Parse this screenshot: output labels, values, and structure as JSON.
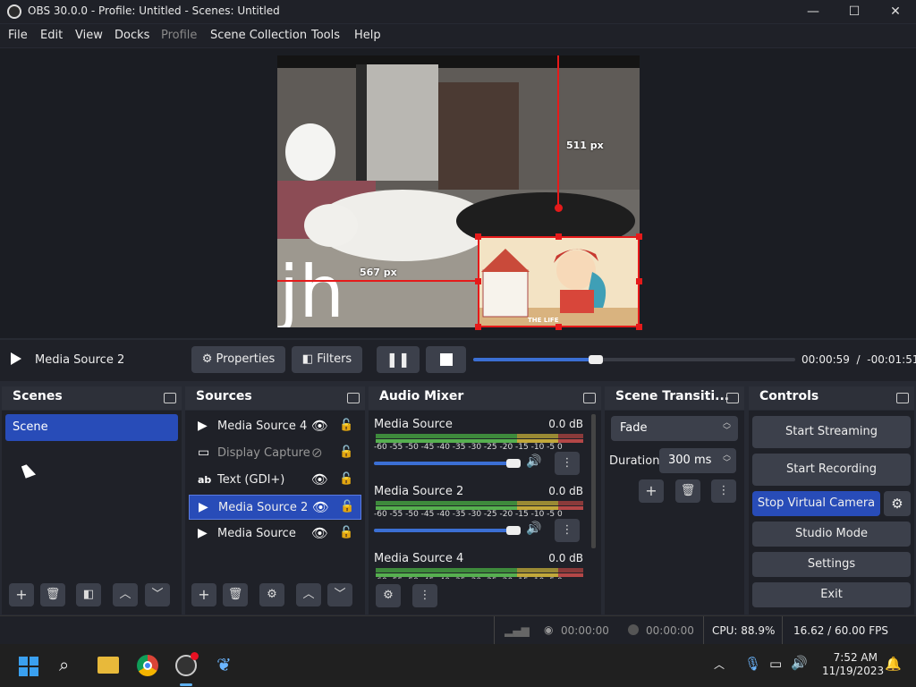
{
  "window": {
    "title": "OBS 30.0.0 - Profile: Untitled - Scenes: Untitled"
  },
  "menu": [
    "File",
    "Edit",
    "View",
    "Docks",
    "Profile",
    "Scene Collection",
    "Tools",
    "Help"
  ],
  "preview": {
    "dim_vertical": "511 px",
    "dim_horizontal": "567 px",
    "overlay_text": "jh",
    "cartoon_caption": "THE LIFE"
  },
  "transport": {
    "source_name": "Media Source 2",
    "properties": "Properties",
    "filters": "Filters",
    "time_current": "00:00:59",
    "time_sep": "/",
    "time_remaining": "-00:01:51",
    "progress": 0.38
  },
  "scenes": {
    "title": "Scenes",
    "items": [
      "Scene"
    ]
  },
  "sources": {
    "title": "Sources",
    "items": [
      {
        "icon": "▶",
        "label": "Media Source 4",
        "visible": true
      },
      {
        "icon": "▭",
        "label": "Display Capture",
        "visible": false
      },
      {
        "icon": "ab",
        "label": "Text (GDI+)",
        "visible": true
      },
      {
        "icon": "▶",
        "label": "Media Source 2",
        "visible": true
      },
      {
        "icon": "▶",
        "label": "Media Source",
        "visible": true
      }
    ]
  },
  "mixer": {
    "title": "Audio Mixer",
    "scale": "-60 -55 -50 -45 -40 -35 -30 -25 -20 -15 -10 -5 0",
    "channels": [
      {
        "name": "Media Source",
        "db": "0.0 dB"
      },
      {
        "name": "Media Source 2",
        "db": "0.0 dB"
      },
      {
        "name": "Media Source 4",
        "db": "0.0 dB"
      }
    ]
  },
  "transitions": {
    "title": "Scene Transiti...",
    "selected": "Fade",
    "duration_label": "Duration",
    "duration_value": "300 ms"
  },
  "controls": {
    "title": "Controls",
    "start_streaming": "Start Streaming",
    "start_recording": "Start Recording",
    "virtual_camera": "Stop Virtual Camera",
    "studio_mode": "Studio Mode",
    "settings": "Settings",
    "exit": "Exit"
  },
  "status": {
    "stream_time": "00:00:00",
    "record_time": "00:00:00",
    "cpu": "CPU: 88.9%",
    "fps": "16.62 / 60.00 FPS"
  },
  "taskbar": {
    "time": "7:52 AM",
    "date": "11/19/2023"
  },
  "colors": {
    "accent": "#284cb8",
    "handle": "#e51a1a"
  }
}
